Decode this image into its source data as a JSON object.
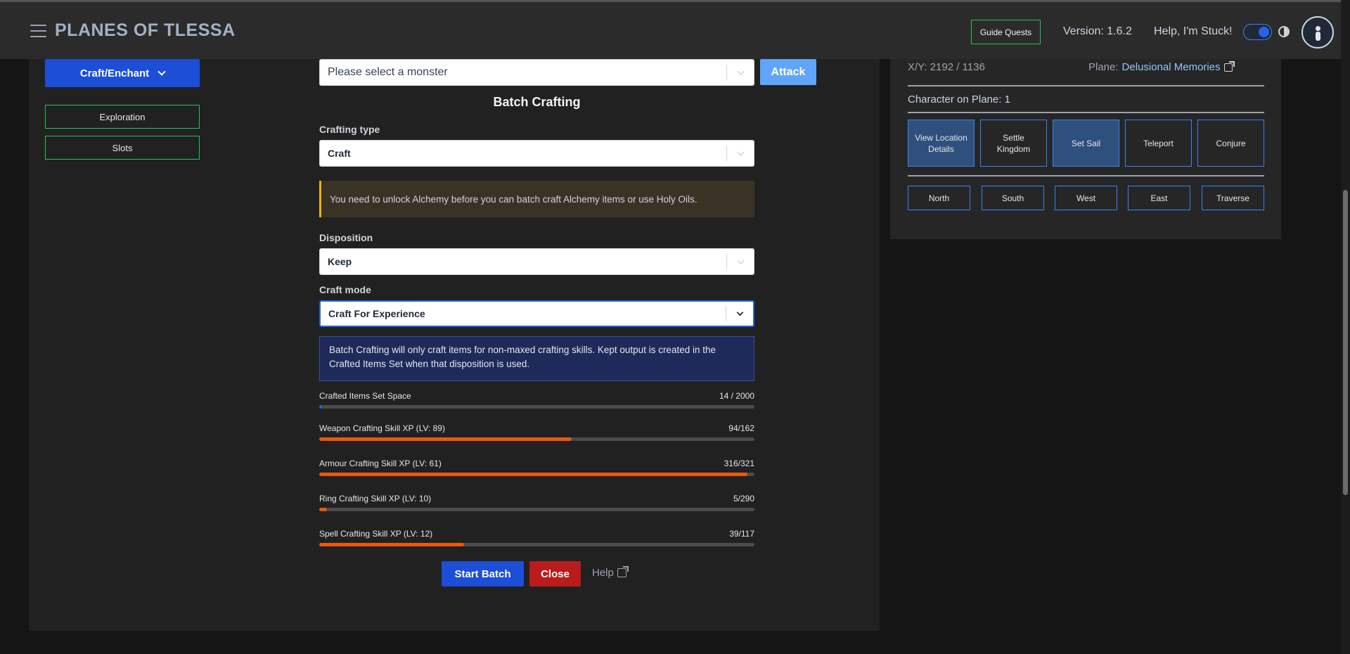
{
  "header": {
    "brand": "PLANES OF TLESSA",
    "guide_quests": "Guide Quests",
    "version": "Version: 1.6.2",
    "stuck": "Help, I'm Stuck!"
  },
  "sidebar": {
    "craft_menu": "Craft/Enchant",
    "items": [
      {
        "label": "Exploration"
      },
      {
        "label": "Slots"
      }
    ]
  },
  "main": {
    "monster_select": {
      "value": "Please select a monster"
    },
    "attack_label": "Attack",
    "title": "Batch Crafting",
    "crafting_type": {
      "label": "Crafting type",
      "value": "Craft"
    },
    "warning": "You need to unlock Alchemy before you can batch craft Alchemy items or use Holy Oils.",
    "disposition": {
      "label": "Disposition",
      "value": "Keep"
    },
    "craft_mode": {
      "label": "Craft mode",
      "value": "Craft For Experience"
    },
    "info": "Batch Crafting will only craft items for non-maxed crafting skills. Kept output is created in the Crafted Items Set when that disposition is used.",
    "bars": [
      {
        "label": "Crafted Items Set Space",
        "value": "14 / 2000",
        "fraction": 0.007,
        "color": "#2563eb"
      },
      {
        "label": "Weapon Crafting Skill XP (LV: 89)",
        "value": "94/162",
        "fraction": 0.58,
        "color": "#ea580c"
      },
      {
        "label": "Armour Crafting Skill XP (LV: 61)",
        "value": "316/321",
        "fraction": 0.984,
        "color": "#ea580c"
      },
      {
        "label": "Ring Crafting Skill XP (LV: 10)",
        "value": "5/290",
        "fraction": 0.017,
        "color": "#ea580c"
      },
      {
        "label": "Spell Crafting Skill XP (LV: 12)",
        "value": "39/117",
        "fraction": 0.333,
        "color": "#ea580c"
      }
    ],
    "start_batch": "Start Batch",
    "close": "Close",
    "help": "Help"
  },
  "map_panel": {
    "coords": "X/Y: 2192 / 1136",
    "plane_label": "Plane:",
    "plane_name": "Delusional Memories",
    "character_on_plane": "Character on Plane: 1",
    "actions": [
      "View Location Details",
      "Settle Kingdom",
      "Set Sail",
      "Teleport",
      "Conjure"
    ],
    "directions": [
      "North",
      "South",
      "West",
      "East",
      "Traverse"
    ]
  }
}
